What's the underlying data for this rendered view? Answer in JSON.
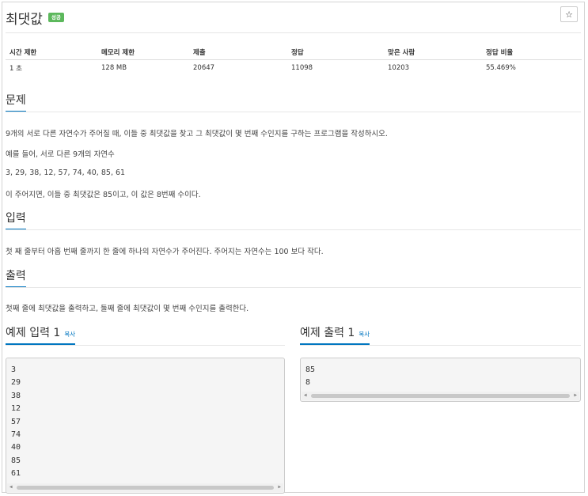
{
  "problem": {
    "title": "최댓값",
    "badge": "성공",
    "star_icon": "☆"
  },
  "info_table": {
    "headers": [
      "시간 제한",
      "메모리 제한",
      "제출",
      "정답",
      "맞은 사람",
      "정답 비율"
    ],
    "values": [
      "1 초",
      "128 MB",
      "20647",
      "11098",
      "10203",
      "55.469%"
    ]
  },
  "sections": {
    "description": {
      "heading": "문제",
      "lines": [
        "9개의 서로 다른 자연수가 주어질 때, 이들 중 최댓값을 찾고 그 최댓값이 몇 번째 수인지를 구하는 프로그램을 작성하시오.",
        "예를 들어, 서로 다른 9개의 자연수",
        "3, 29, 38, 12, 57, 74, 40, 85, 61",
        "이 주어지면, 이들 중 최댓값은 85이고, 이 값은 8번째 수이다."
      ]
    },
    "input": {
      "heading": "입력",
      "text": "첫 째 줄부터 아홉 번째 줄까지 한 줄에 하나의 자연수가 주어진다. 주어지는 자연수는 100 보다 작다."
    },
    "output": {
      "heading": "출력",
      "text": "첫째 줄에 최댓값을 출력하고, 둘째 줄에 최댓값이 몇 번째 수인지를 출력한다."
    }
  },
  "samples": {
    "input": {
      "heading": "예제 입력 1",
      "copy_label": "복사",
      "lines": [
        "3",
        "29",
        "38",
        "12",
        "57",
        "74",
        "40",
        "85",
        "61"
      ]
    },
    "output": {
      "heading": "예제 출력 1",
      "copy_label": "복사",
      "lines": [
        "85",
        "8"
      ]
    }
  },
  "colors": {
    "accent": "#0076c0",
    "success_badge": "#5cb85c"
  }
}
